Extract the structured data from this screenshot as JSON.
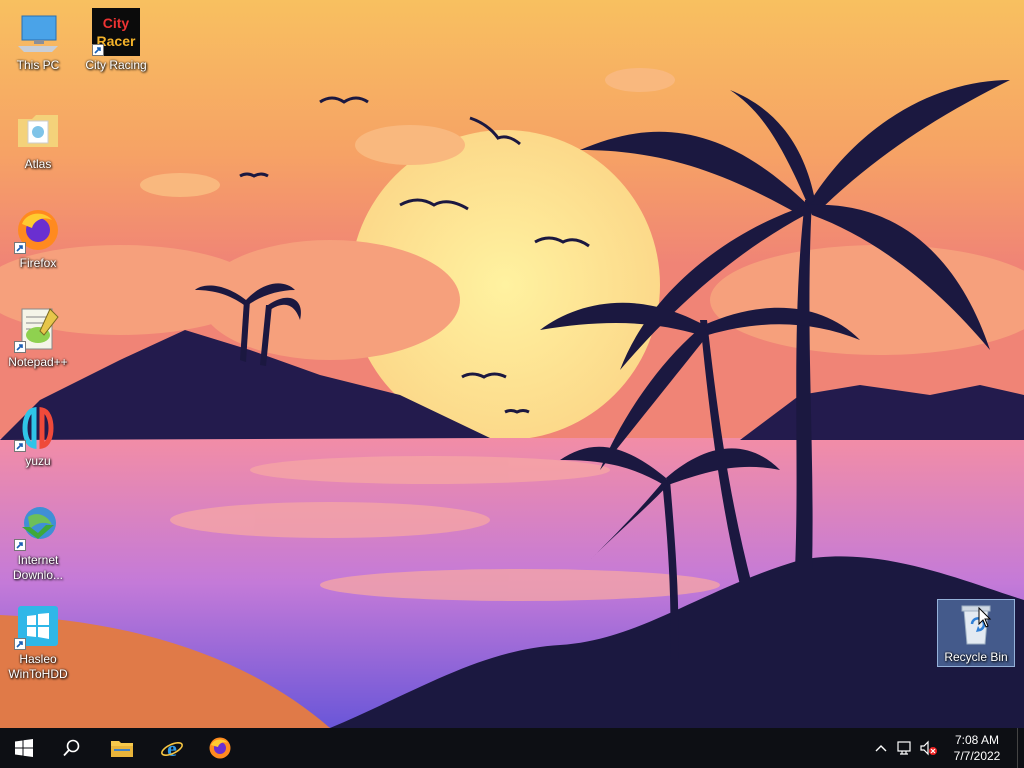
{
  "desktop": {
    "icons": [
      {
        "label": "This PC",
        "icon": "computer-icon"
      },
      {
        "label": "City Racing",
        "icon": "city-racer-game-icon",
        "logo_text": [
          "City",
          "Racer"
        ]
      },
      {
        "label": "Atlas",
        "icon": "folder-icon"
      },
      {
        "label": "Firefox",
        "icon": "firefox-icon"
      },
      {
        "label": "Notepad++",
        "icon": "notepad-plus-plus-icon"
      },
      {
        "label": "yuzu",
        "icon": "yuzu-icon"
      },
      {
        "label": "Internet Downlo...",
        "icon": "internet-download-manager-icon"
      },
      {
        "label": "Hasleo WinToHDD",
        "icon": "wintohdd-icon"
      },
      {
        "label": "Recycle Bin",
        "icon": "recycle-bin-icon",
        "selected": true
      }
    ]
  },
  "taskbar": {
    "buttons": [
      {
        "name": "start",
        "icon": "windows-logo-icon"
      },
      {
        "name": "search",
        "icon": "search-icon"
      },
      {
        "name": "file-explorer",
        "icon": "folder-icon"
      },
      {
        "name": "internet-explorer",
        "icon": "internet-explorer-icon"
      },
      {
        "name": "firefox",
        "icon": "firefox-icon"
      }
    ],
    "tray": {
      "icons": [
        "chevron-up-icon",
        "network-icon",
        "volume-muted-icon"
      ],
      "time": "7:08 AM",
      "date": "7/7/2022"
    }
  },
  "colors": {
    "taskbar": "#0d0f14",
    "sky_top": "#f7b35a",
    "sky_bottom": "#f08a6f",
    "silhouette": "#1c1942",
    "water": "#a46ee2",
    "sand": "#e07a48"
  }
}
